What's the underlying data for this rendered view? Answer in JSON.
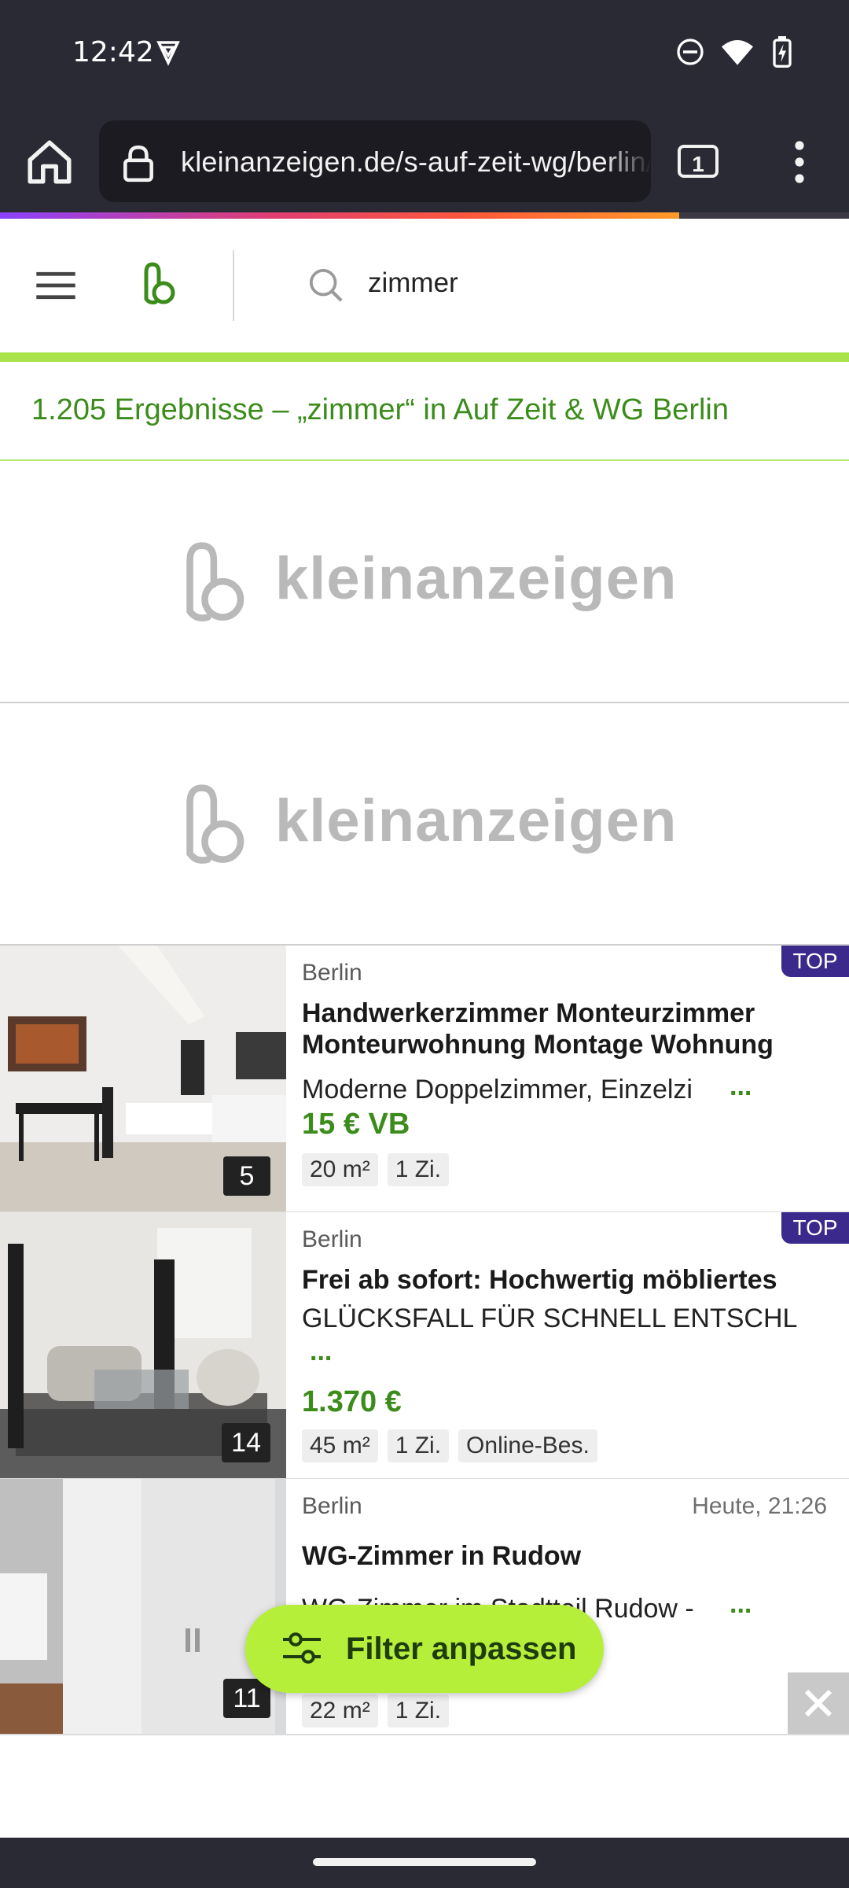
{
  "status_bar": {
    "time": "12:42"
  },
  "browser": {
    "url": "kleinanzeigen.de/s-auf-zeit-wg/berlin/zimmer",
    "tab_count": "1"
  },
  "site": {
    "search_query": "zimmer",
    "brand_name": "kleinanzeigen",
    "results_text": "1.205 Ergebnisse – „zimmer“ in Auf Zeit & WG Berlin"
  },
  "listings": [
    {
      "city": "Berlin",
      "badge": "TOP",
      "title": "Handwerkerzimmer Monteurzimmer Monteurwohnung Montage Wohnung",
      "description": "Moderne Doppelzimmer, Einzelzi",
      "more": "...",
      "price": "15 € VB",
      "tags": [
        "20 m²",
        "1 Zi."
      ],
      "image_count": "5"
    },
    {
      "city": "Berlin",
      "badge": "TOP",
      "title": "Frei ab sofort: Hochwertig möbliertes",
      "description": "GLÜCKSFALL FÜR SCHNELL ENTSCHL",
      "more": "...",
      "price": "1.370 €",
      "tags": [
        "45 m²",
        "1 Zi.",
        "Online-Bes."
      ],
      "image_count": "14"
    },
    {
      "city": "Berlin",
      "date": "Heute, 21:26",
      "title": "WG-Zimmer in Rudow",
      "description": "WG-Zimmer im Stadtteil Rudow -",
      "more": "...",
      "tags": [
        "22 m²",
        "1 Zi."
      ],
      "image_count": "11"
    }
  ],
  "fab": {
    "label": "Filter anpassen"
  },
  "colors": {
    "brand_green": "#3c8c1c",
    "accent_lime": "#b5ef3a",
    "top_badge": "#3b2a8c"
  }
}
